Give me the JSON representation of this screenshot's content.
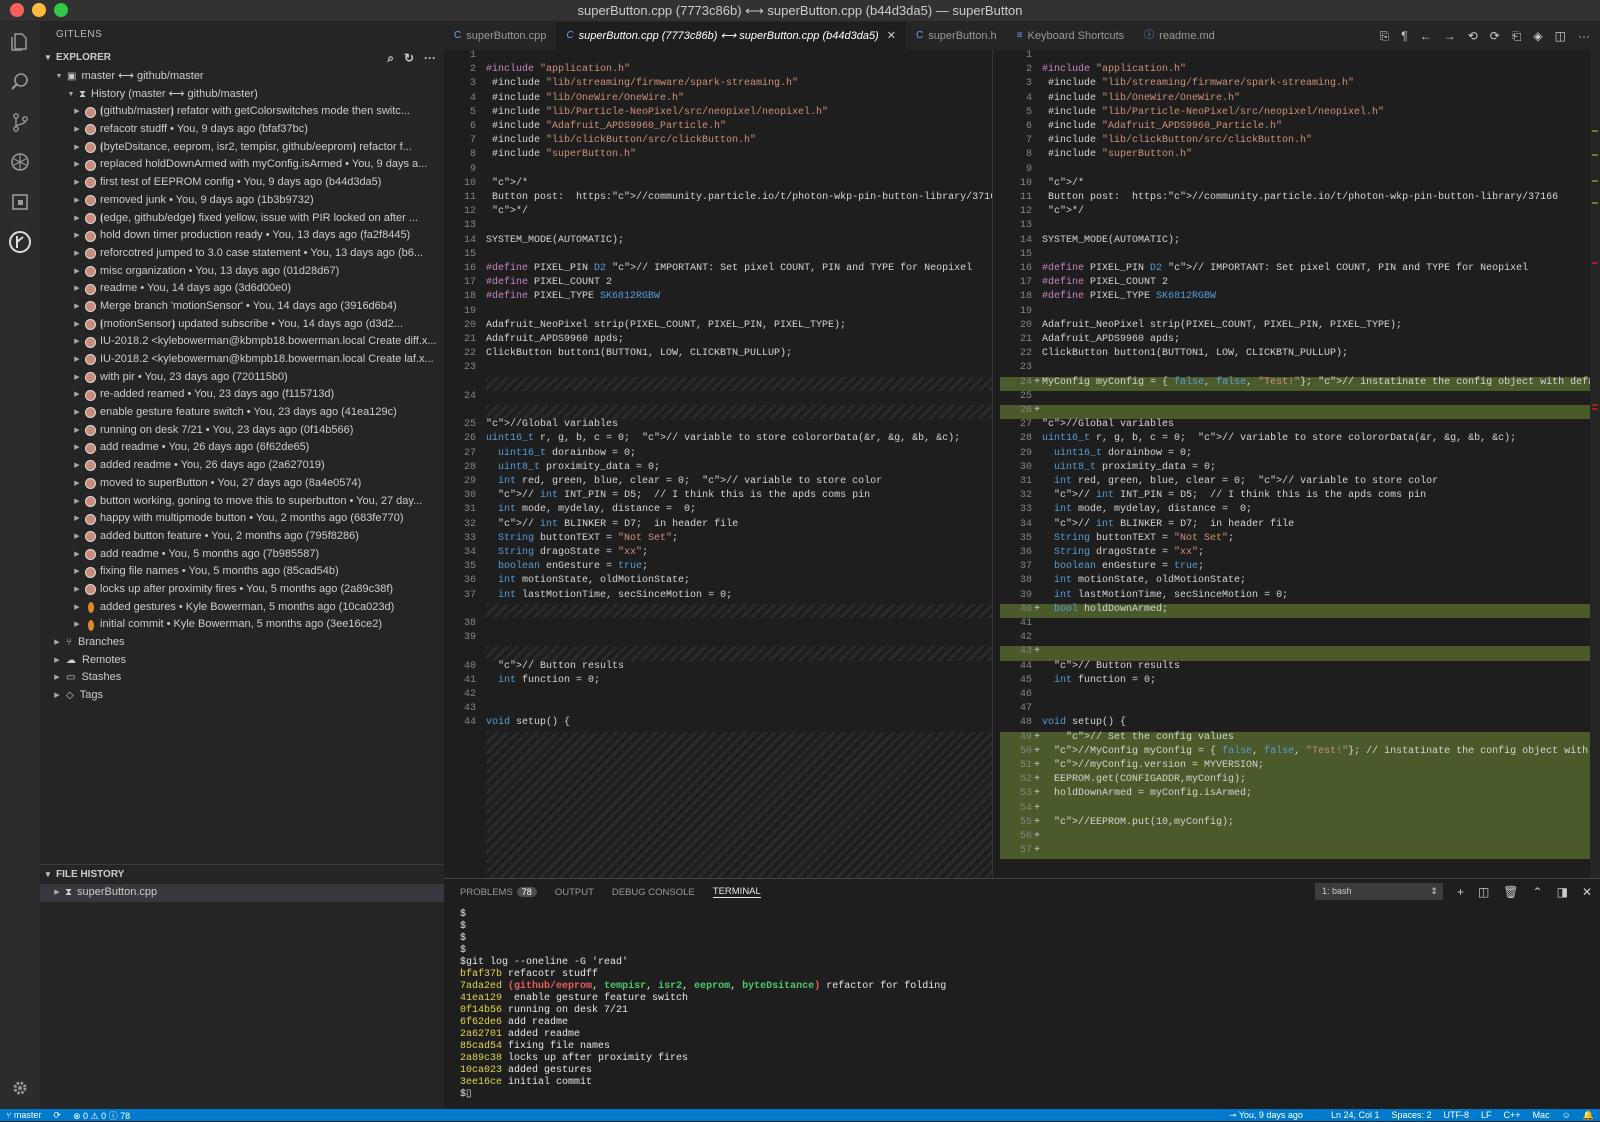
{
  "window": {
    "title": "superButton.cpp (7773c86b) ⟷ superButton.cpp (b44d3da5) — superButton"
  },
  "sidebar": {
    "title": "GITLENS",
    "explorer_label": "EXPLORER",
    "branch_row": "master ⟷ github/master",
    "history_row": "History (master ⟷ github/master)",
    "commits": [
      {
        "text": "⦗github/master⦘ refator with getColorswitches mode then switc...",
        "avatar": "face"
      },
      {
        "text": "refacotr studff  •  You, 9 days ago  (bfaf37bc)",
        "avatar": "face"
      },
      {
        "text": "⦗byteDsitance, eeprom, isr2, tempisr, github/eeprom⦘ refactor f...",
        "avatar": "face"
      },
      {
        "text": "replaced holdDownArmed with myConfig.isArmed  •  You, 9 days a...",
        "avatar": "face"
      },
      {
        "text": "first test of EEPROM config  •  You, 9 days ago  (b44d3da5)",
        "avatar": "face"
      },
      {
        "text": "removed junk  •  You, 9 days ago  (1b3b9732)",
        "avatar": "face"
      },
      {
        "text": "⦗edge, github/edge⦘ fixed yellow, issue with PIR locked on after ...",
        "avatar": "face"
      },
      {
        "text": "hold down timer production ready  •  You, 13 days ago  (fa2f8445)",
        "avatar": "face"
      },
      {
        "text": "reforcotred jumped to 3.0 case statement  •  You, 13 days ago  (b6...",
        "avatar": "face"
      },
      {
        "text": "misc organization  •  You, 13 days ago  (01d28d67)",
        "avatar": "face"
      },
      {
        "text": "readme  •  You, 14 days ago  (3d6d00e0)",
        "avatar": "face"
      },
      {
        "text": "Merge branch 'motionSensor'  •  You, 14 days ago  (3916d6b4)",
        "avatar": "face"
      },
      {
        "text": "⦗motionSensor⦘ updated subscribe  •  You, 14 days ago  (d3d2...",
        "avatar": "face"
      },
      {
        "text": "IU-2018.2 <kylebowerman@kbmpb18.bowerman.local Create diff.x...",
        "avatar": "face"
      },
      {
        "text": "IU-2018.2 <kylebowerman@kbmpb18.bowerman.local Create laf.x...",
        "avatar": "face"
      },
      {
        "text": "with pir  •  You, 23 days ago  (720115b0)",
        "avatar": "face"
      },
      {
        "text": "re-added reamed  •  You, 23 days ago  (f115713d)",
        "avatar": "face"
      },
      {
        "text": "enable gesture feature switch  •  You, 23 days ago  (41ea129c)",
        "avatar": "face"
      },
      {
        "text": "running on desk 7/21  •  You, 23 days ago  (0f14b566)",
        "avatar": "face"
      },
      {
        "text": "add readme  •  You, 26 days ago  (6f62de65)",
        "avatar": "face"
      },
      {
        "text": "added readme  •  You, 26 days ago  (2a627019)",
        "avatar": "face"
      },
      {
        "text": "moved to superButton  •  You, 27 days ago  (8a4e0574)",
        "avatar": "face"
      },
      {
        "text": "button working, goning to move this to superbutton  •  You, 27 day...",
        "avatar": "face"
      },
      {
        "text": "happy with multipmode button  •  You, 2 months ago  (683fe770)",
        "avatar": "face"
      },
      {
        "text": "added button feature  •  You, 2 months ago  (795f8286)",
        "avatar": "face"
      },
      {
        "text": "add readme  •  You, 5 months ago  (7b985587)",
        "avatar": "face"
      },
      {
        "text": "fixing file names  •  You, 5 months ago  (85cad54b)",
        "avatar": "face"
      },
      {
        "text": "locks up after proximity fires  •  You, 5 months ago  (2a89c38f)",
        "avatar": "face"
      },
      {
        "text": "added gestures  •  Kyle Bowerman, 5 months ago  (10ca023d)",
        "avatar": "orange"
      },
      {
        "text": "initial commit  •  Kyle Bowerman, 5 months ago  (3ee16ce2)",
        "avatar": "orange"
      }
    ],
    "groups": [
      "Branches",
      "Remotes",
      "Stashes",
      "Tags"
    ],
    "file_history_label": "FILE HISTORY",
    "file_history_item": "superButton.cpp"
  },
  "tabs": [
    {
      "label": "superButton.cpp",
      "icon": "C"
    },
    {
      "label": "superButton.cpp (7773c86b) ⟷ superButton.cpp (b44d3da5)",
      "icon": "C",
      "active": true
    },
    {
      "label": "superButton.h",
      "icon": "C"
    },
    {
      "label": "Keyboard Shortcuts",
      "icon": "≡"
    },
    {
      "label": "readme.md",
      "icon": "ⓘ"
    }
  ],
  "panel": {
    "tabs": [
      "PROBLEMS",
      "OUTPUT",
      "DEBUG CONSOLE",
      "TERMINAL"
    ],
    "problems_count": "78",
    "terminal_select": "1: bash",
    "terminal_lines": [
      {
        "hash": "",
        "text": "$"
      },
      {
        "hash": "",
        "text": "$"
      },
      {
        "hash": "",
        "text": "$"
      },
      {
        "hash": "",
        "text": "$"
      },
      {
        "hash": "",
        "text": "$git log --oneline -G 'read'"
      },
      {
        "hash": "bfaf37b",
        "text": " refacotr studff"
      },
      {
        "hash": "7ada2ed",
        "refs": true,
        "text": " refactor for folding"
      },
      {
        "hash": "41ea129",
        "text": "  enable gesture feature switch"
      },
      {
        "hash": "0f14b56",
        "text": " running on desk 7/21"
      },
      {
        "hash": "6f62de6",
        "text": " add readme"
      },
      {
        "hash": "2a62701",
        "text": " added readme"
      },
      {
        "hash": "85cad54",
        "text": " fixing file names"
      },
      {
        "hash": "2a89c38",
        "text": " locks up after proximity fires"
      },
      {
        "hash": "10ca023",
        "text": " added gestures"
      },
      {
        "hash": "3ee16ce",
        "text": " initial commit"
      },
      {
        "hash": "",
        "text": "$▯"
      }
    ],
    "refs_text": {
      "open": "(",
      "red": "github/eeprom",
      "sep": ", ",
      "g1": "tempisr",
      "g2": "isr2",
      "g3": "eeprom",
      "g4": "byteDsitance",
      "close": ")"
    }
  },
  "status": {
    "branch": "master",
    "problems": "⊗ 0  ⚠ 0  ⓘ 78",
    "blame": "You, 9 days ago",
    "position": "Ln 24, Col 1",
    "spaces": "Spaces: 2",
    "encoding": "UTF-8",
    "eol": "LF",
    "language": "C++",
    "platform": "Mac"
  }
}
